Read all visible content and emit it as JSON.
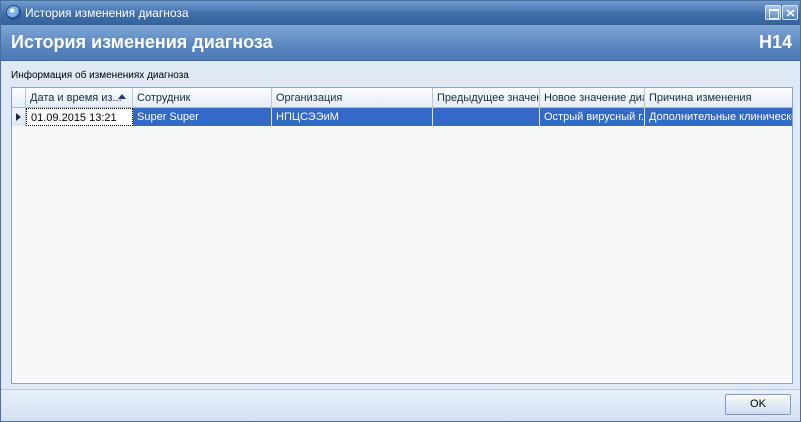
{
  "window": {
    "title": "История изменения диагноза"
  },
  "header": {
    "title": "История изменения диагноза",
    "code": "H14"
  },
  "section": {
    "label": "Информация об изменениях диагноза"
  },
  "grid": {
    "columns": [
      "Дата и время из...",
      "Сотрудник",
      "Организация",
      "Предыдущее значен...",
      "Новое значение диа...",
      "Причина изменения"
    ],
    "sorted_column": "Дата и время из...",
    "sort_direction": "ascending",
    "rows": [
      {
        "datetime": "01.09.2015 13:21",
        "employee": "Super Super",
        "organization": "НПЦСЭЭиМ",
        "previous_value": "",
        "new_value": "Острый вирусный г...",
        "reason": "Дополнительные клиническо..."
      }
    ]
  },
  "footer": {
    "ok_label": "OK"
  },
  "colors": {
    "selection": "#3468c9",
    "header_bg": "#5a86bf",
    "titlebar_bg": "#3f6ea8"
  },
  "icons": {
    "app": "app-logo-icon",
    "maximize": "maximize-icon",
    "close": "close-icon",
    "sort": "sort-ascending-icon",
    "row_indicator": "current-row-indicator-icon"
  }
}
